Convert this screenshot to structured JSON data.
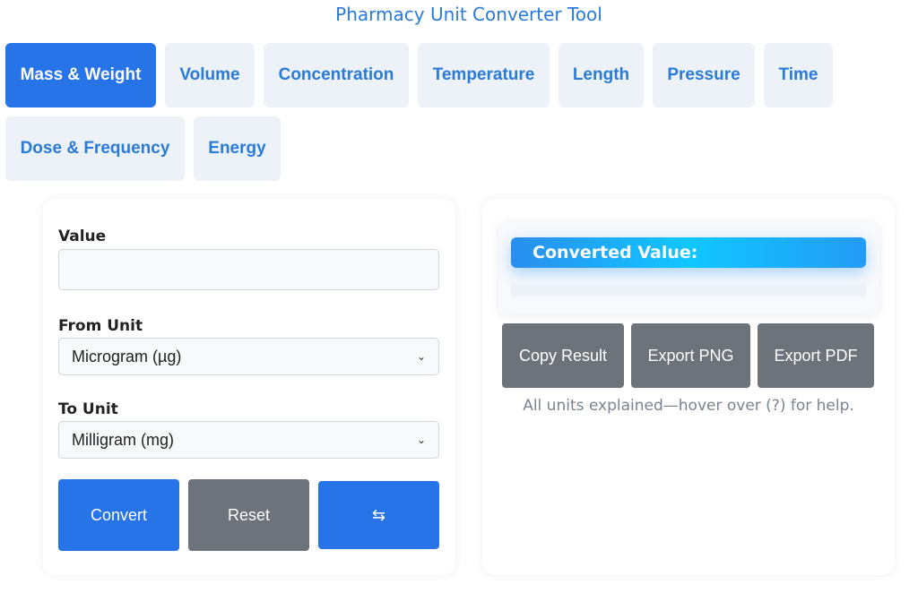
{
  "app": {
    "title": "Pharmacy Unit Converter Tool"
  },
  "tabs": [
    {
      "label": "Mass & Weight",
      "active": true
    },
    {
      "label": "Volume",
      "active": false
    },
    {
      "label": "Concentration",
      "active": false
    },
    {
      "label": "Temperature",
      "active": false
    },
    {
      "label": "Length",
      "active": false
    },
    {
      "label": "Pressure",
      "active": false
    },
    {
      "label": "Time",
      "active": false
    },
    {
      "label": "Dose & Frequency",
      "active": false
    },
    {
      "label": "Energy",
      "active": false
    }
  ],
  "form": {
    "value_label": "Value",
    "value_input": "",
    "from_label": "From Unit",
    "from_selected": "Microgram (µg)",
    "to_label": "To Unit",
    "to_selected": "Milligram (mg)",
    "convert_label": "Convert",
    "reset_label": "Reset",
    "swap_label": "⇆"
  },
  "result": {
    "heading": "Converted Value:",
    "value": "",
    "copy_label": "Copy Result",
    "export_png_label": "Export PNG",
    "export_pdf_label": "Export PDF",
    "help_text": "All units explained—hover over (?) for help."
  },
  "colors": {
    "accent": "#2774e9",
    "tab_bg": "#edf2f8",
    "tab_text": "#2a7ad8",
    "button_grey": "#6c737b"
  },
  "icons": {
    "select_chevron": "chevron-down-icon",
    "swap": "swap-icon"
  }
}
